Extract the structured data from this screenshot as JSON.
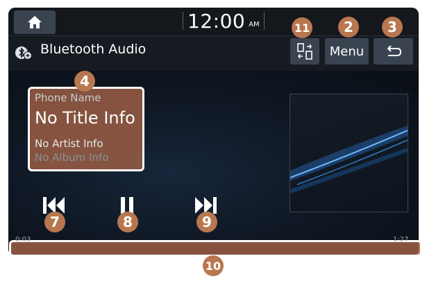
{
  "status_bar": {
    "time": "12:00",
    "ampm": "AM"
  },
  "title_bar": {
    "title": "Bluetooth Audio",
    "menu_label": "Menu"
  },
  "track": {
    "phone_name": "Phone Name",
    "title": "No Title Info",
    "artist": "No Artist Info",
    "album": "No Album Info"
  },
  "progress": {
    "elapsed": "0:03",
    "total": "1:27",
    "fraction": 0.034
  },
  "callouts": {
    "c2": "2",
    "c3": "3",
    "c4": "4",
    "c7": "7",
    "c8": "8",
    "c9": "9",
    "c10": "10",
    "c11": "11"
  },
  "icons": {
    "home": "home-icon",
    "bluetooth": "bluetooth-icon",
    "back": "back-icon",
    "switch": "switch-source-icon",
    "prev": "previous-track-icon",
    "pause": "pause-icon",
    "next": "next-track-icon"
  },
  "colors": {
    "highlight": "#b8774f",
    "button": "#3a4350",
    "background": "#0c1118"
  }
}
